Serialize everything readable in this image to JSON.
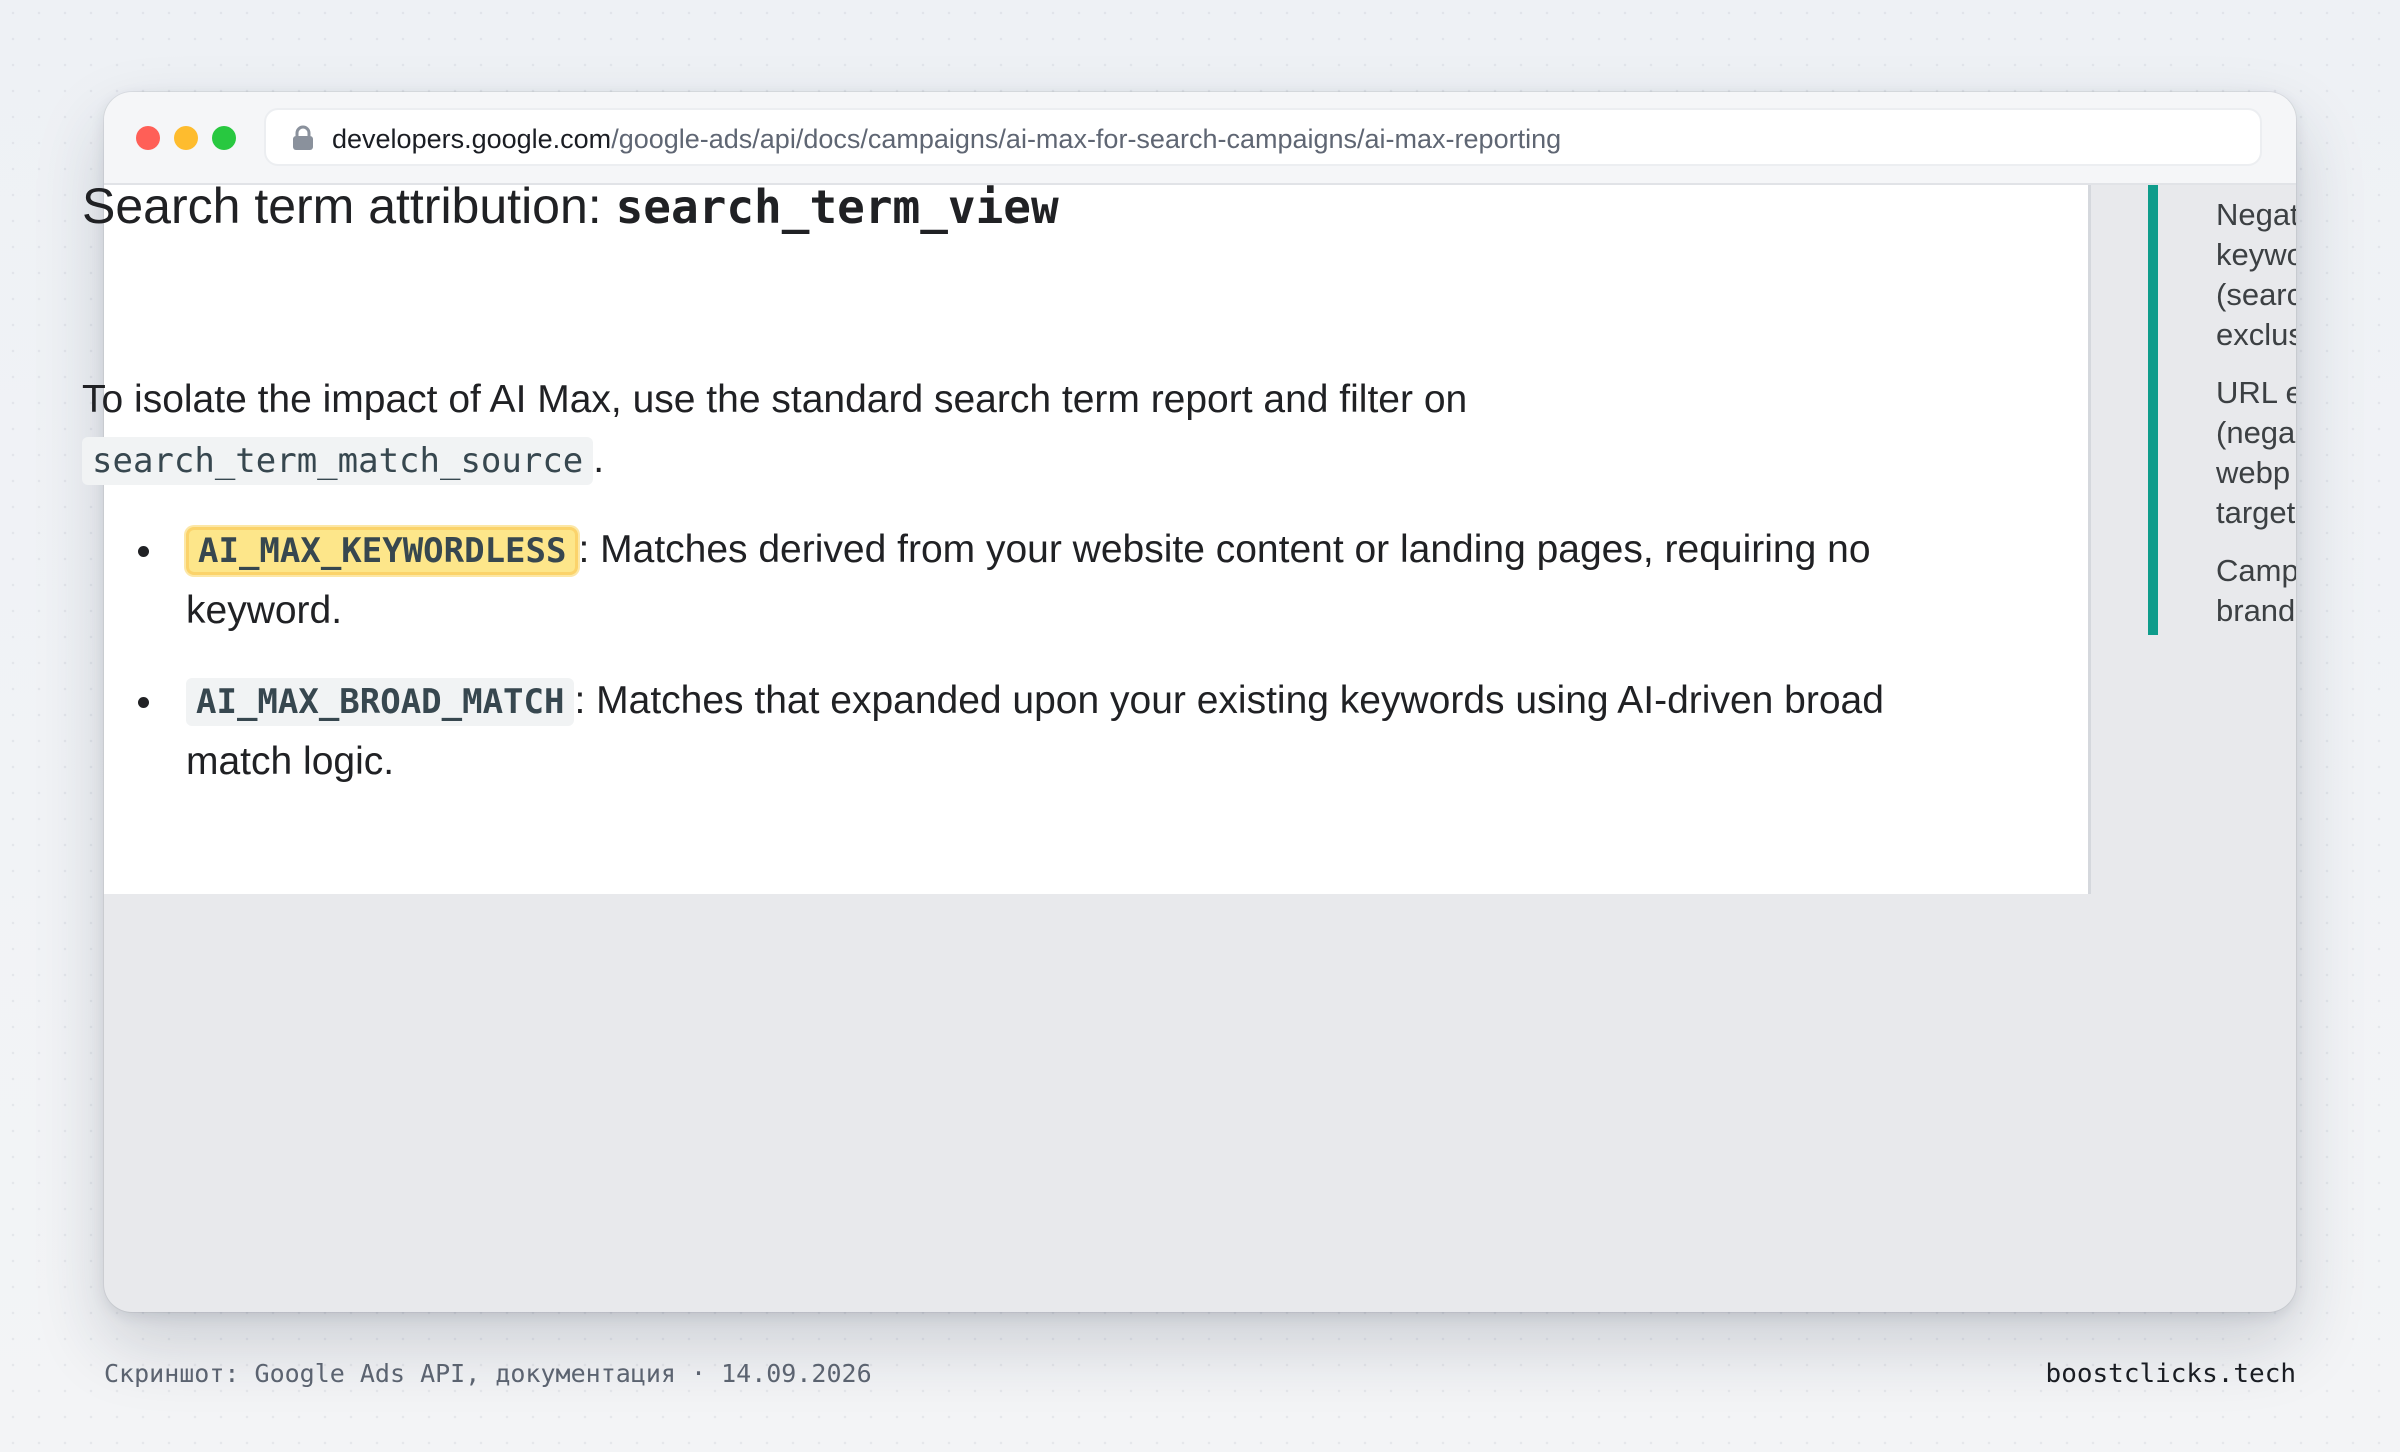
{
  "browser": {
    "url_domain": "developers.google.com",
    "url_path": "/google-ads/api/docs/campaigns/ai-max-for-search-campaigns/ai-max-reporting"
  },
  "article": {
    "heading_text": "Search term attribution: ",
    "heading_code": "search_term_view",
    "intro_text": "To isolate the impact of AI Max, use the standard search term report and filter on ",
    "intro_code": "search_term_match_source",
    "intro_end": ".",
    "bullets": [
      {
        "code": "AI_MAX_KEYWORDLESS",
        "text": ": Matches derived from your website content or landing pages, requiring no keyword."
      },
      {
        "code": "AI_MAX_BROAD_MATCH",
        "text": ": Matches that expanded upon your existing keywords using AI-driven broad match logic."
      }
    ]
  },
  "sidebar": {
    "accent_color": "#0e9c8b",
    "items": [
      "Negat\nkeywo\n(searc\nexclus",
      "URL e\n(nega\nwebp\ntarget",
      "Camp\nbrand"
    ]
  },
  "footer": {
    "caption": "Скриншот: Google Ads API, документация · 14.09.2026",
    "brand": "boostclicks.tech"
  },
  "colors": {
    "highlight": "#fde68a",
    "traffic_red": "#ff5f57",
    "traffic_yellow": "#febc2e",
    "traffic_green": "#28c840"
  }
}
